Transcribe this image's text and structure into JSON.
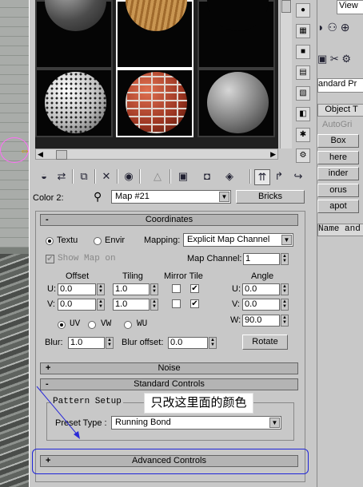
{
  "material_slots": [
    {
      "name": "noise-sphere",
      "color": "#6b6b6b"
    },
    {
      "name": "wood-sphere",
      "color": "#c09050"
    },
    {
      "name": "black-sphere",
      "color": "#050505"
    },
    {
      "name": "dots-sphere",
      "color": "#e6e6e6"
    },
    {
      "name": "bricks-sphere",
      "color": "#b44a2c"
    },
    {
      "name": "gray-sphere",
      "color": "#8a8a8a"
    }
  ],
  "map": {
    "color_label": "Color 2:",
    "map_name": "Map #21",
    "map_type": "Bricks"
  },
  "coordinates": {
    "header": "Coordinates",
    "texture_label": "Textu",
    "environ_label": "Envir",
    "mapping_label": "Mapping:",
    "mapping_value": "Explicit Map Channel",
    "show_map_on": "Show Map on",
    "map_channel_label": "Map Channel:",
    "map_channel_value": "1",
    "offset_label": "Offset",
    "tiling_label": "Tiling",
    "mirror_tile_label": "Mirror Tile",
    "angle_label": "Angle",
    "u_label": "U:",
    "v_label": "V:",
    "w_label": "W:",
    "u_offset": "0.0",
    "v_offset": "0.0",
    "u_tiling": "1.0",
    "v_tiling": "1.0",
    "u_angle": "0.0",
    "v_angle": "0.0",
    "w_angle": "90.0",
    "uv_label": "UV",
    "vw_label": "VW",
    "wu_label": "WU",
    "blur_label": "Blur:",
    "blur_value": "1.0",
    "blur_offset_label": "Blur offset:",
    "blur_offset_value": "0.0",
    "rotate_label": "Rotate"
  },
  "noise": {
    "header": "Noise"
  },
  "standard_controls": {
    "header": "Standard Controls",
    "pattern_setup": "Pattern Setup",
    "preset_type_label": "Preset Type :",
    "preset_type_value": "Running Bond"
  },
  "advanced_controls": {
    "header": "Advanced Controls"
  },
  "annotation": "只改这里面的颜色",
  "right_panel": {
    "view": "View",
    "standard_pr": "andard Pr",
    "object_t": "Object T",
    "autogri": "AutoGri",
    "box": "Box",
    "sphere": "here",
    "cylinder": "inder",
    "torus": "orus",
    "teapot": "apot",
    "name_and": "Name and"
  },
  "plus": "+",
  "minus": "-",
  "check": "✔"
}
